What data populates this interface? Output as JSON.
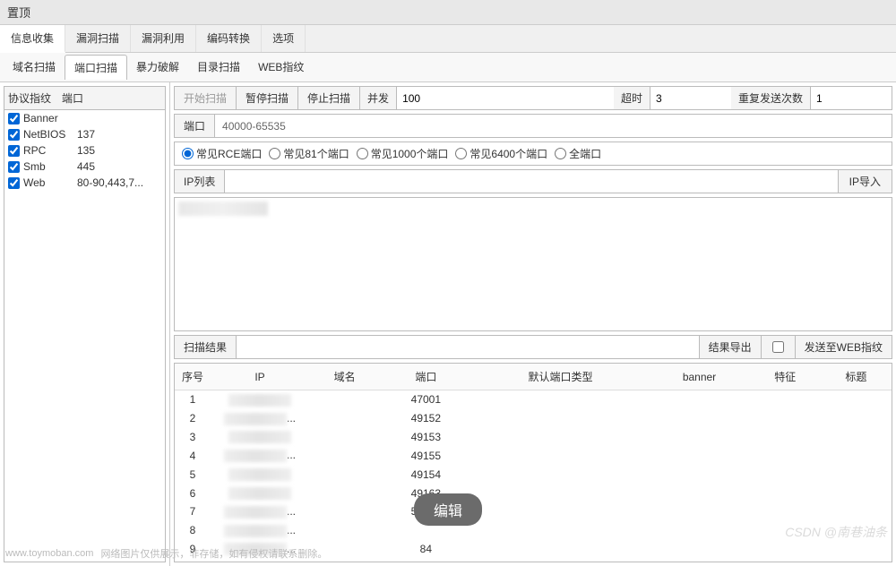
{
  "window": {
    "title": "置顶"
  },
  "main_tabs": [
    {
      "label": "信息收集",
      "active": true
    },
    {
      "label": "漏洞扫描"
    },
    {
      "label": "漏洞利用"
    },
    {
      "label": "编码转换"
    },
    {
      "label": "选项"
    }
  ],
  "sub_tabs": [
    {
      "label": "域名扫描"
    },
    {
      "label": "端口扫描",
      "active": true
    },
    {
      "label": "暴力破解"
    },
    {
      "label": "目录扫描"
    },
    {
      "label": "WEB指纹"
    }
  ],
  "proto_panel": {
    "col_protocol": "协议指纹",
    "col_port": "端口",
    "items": [
      {
        "name": "Banner",
        "port": "",
        "checked": true
      },
      {
        "name": "NetBIOS",
        "port": "137",
        "checked": true
      },
      {
        "name": "RPC",
        "port": "135",
        "checked": true
      },
      {
        "name": "Smb",
        "port": "445",
        "checked": true
      },
      {
        "name": "Web",
        "port": "80-90,443,7...",
        "checked": true
      }
    ]
  },
  "toolbar": {
    "start": "开始扫描",
    "pause": "暂停扫描",
    "stop": "停止扫描",
    "threads_label": "并发",
    "threads_value": "100",
    "timeout_label": "超时",
    "timeout_value": "3",
    "retry_label": "重复发送次数",
    "retry_value": "1"
  },
  "port_row": {
    "label": "端口",
    "value": "40000-65535"
  },
  "radio_row": {
    "options": [
      {
        "label": "常见RCE端口",
        "checked": true
      },
      {
        "label": "常见81个端口"
      },
      {
        "label": "常见1000个端口"
      },
      {
        "label": "常见6400个端口"
      },
      {
        "label": "全端口"
      }
    ]
  },
  "iplist": {
    "label": "IP列表",
    "import_btn": "IP导入"
  },
  "results": {
    "label": "扫描结果",
    "export_btn": "结果导出",
    "send_btn": "发送至WEB指纹",
    "columns": [
      "序号",
      "IP",
      "域名",
      "端口",
      "默认端口类型",
      "banner",
      "特征",
      "标题"
    ],
    "rows": [
      {
        "idx": "1",
        "port": "47001"
      },
      {
        "idx": "2",
        "port": "49152",
        "dots": true
      },
      {
        "idx": "3",
        "port": "49153"
      },
      {
        "idx": "4",
        "port": "49155",
        "dots": true
      },
      {
        "idx": "5",
        "port": "49154"
      },
      {
        "idx": "6",
        "port": "49163"
      },
      {
        "idx": "7",
        "port": "55928",
        "dots": true
      },
      {
        "idx": "8",
        "port": "",
        "dots": true
      },
      {
        "idx": "9",
        "port": "84",
        "dots": true
      }
    ]
  },
  "overlay": {
    "edit": "编辑"
  },
  "watermark": "CSDN @南巷油条",
  "footer": {
    "site": "www.toymoban.com",
    "note": "网络图片仅供展示，非存储，如有侵权请联系删除。"
  }
}
